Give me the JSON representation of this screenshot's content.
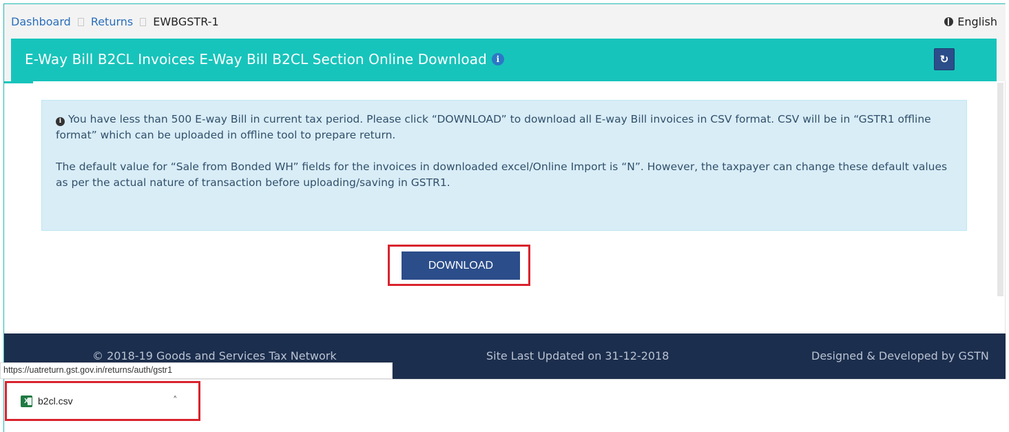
{
  "breadcrumb": {
    "items": [
      "Dashboard",
      "Returns"
    ],
    "current": "EWBGSTR-1"
  },
  "language": {
    "label": "English",
    "icon": "globe-icon"
  },
  "header": {
    "title": "E-Way Bill B2CL Invoices E-Way Bill B2CL Section Online Download",
    "info_icon": "i",
    "refresh_icon": "↻",
    "color": "#17c4bb"
  },
  "info_box": {
    "icon": "i",
    "paragraph1": "You have less than 500 E-way Bill in current tax period. Please click “DOWNLOAD” to download all E-way Bill invoices in CSV format. CSV will be in “GSTR1 offline format” which can be uploaded in offline tool to prepare return.",
    "paragraph2": "The default value for “Sale from Bonded WH” fields for the invoices in downloaded excel/Online Import is “N”. However, the taxpayer can change these default values as per the actual nature of transaction before uploading/saving in GSTR1."
  },
  "download_button": {
    "label": "DOWNLOAD",
    "color": "#2b4d8a"
  },
  "footer": {
    "copyright": "© 2018-19 Goods and Services Tax Network",
    "updated": "Site Last Updated on 31-12-2018",
    "designed": "Designed & Developed by GSTN"
  },
  "status_bar": {
    "url": "https://uatreturn.gst.gov.in/returns/auth/gstr1"
  },
  "download_shelf": {
    "file_name": "b2cl.csv",
    "file_icon_letter": "X",
    "chevron": "˄"
  }
}
